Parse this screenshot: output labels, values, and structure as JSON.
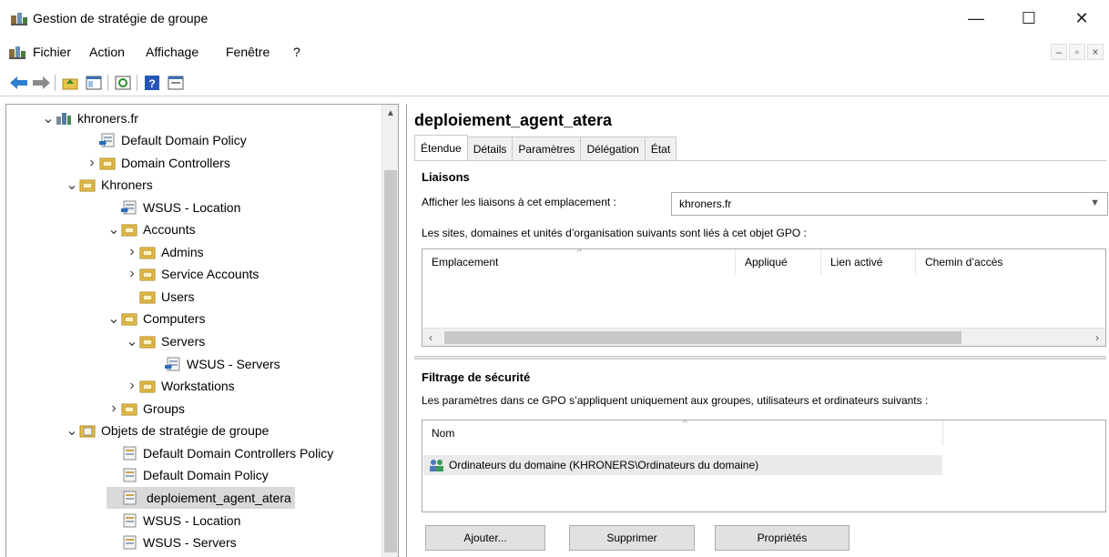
{
  "window": {
    "title": "Gestion de stratégie de groupe",
    "minimize_glyph": "—",
    "maximize_glyph": "☐",
    "close_glyph": "✕"
  },
  "menu": {
    "items": [
      "Fichier",
      "Action",
      "Affichage",
      "Fenêtre",
      "?"
    ],
    "mdi_minimize": "–",
    "mdi_restore": "▫",
    "mdi_close": "×"
  },
  "toolbar": {
    "icons": [
      "back-arrow-icon",
      "forward-arrow-icon",
      "up-folder-icon",
      "show-hide-tree-icon",
      "refresh-icon",
      "help-icon",
      "properties-icon"
    ]
  },
  "tree": {
    "nodes": [
      {
        "label": "khroners.fr",
        "expander": "open",
        "icon": "domain-icon"
      },
      {
        "label": "Default Domain Policy",
        "expander": "none",
        "icon": "gpo-link-icon"
      },
      {
        "label": "Domain Controllers",
        "expander": "closed",
        "icon": "ou-folder-icon"
      },
      {
        "label": "Khroners",
        "expander": "open",
        "icon": "ou-folder-icon"
      },
      {
        "label": "WSUS - Location",
        "expander": "none",
        "icon": "gpo-link-icon"
      },
      {
        "label": "Accounts",
        "expander": "open",
        "icon": "ou-folder-icon"
      },
      {
        "label": "Admins",
        "expander": "closed",
        "icon": "ou-folder-icon"
      },
      {
        "label": "Service Accounts",
        "expander": "closed",
        "icon": "ou-folder-icon"
      },
      {
        "label": "Users",
        "expander": "none",
        "icon": "ou-folder-icon"
      },
      {
        "label": "Computers",
        "expander": "open",
        "icon": "ou-folder-icon"
      },
      {
        "label": "Servers",
        "expander": "open",
        "icon": "ou-folder-icon"
      },
      {
        "label": "WSUS - Servers",
        "expander": "none",
        "icon": "gpo-link-icon"
      },
      {
        "label": "Workstations",
        "expander": "closed",
        "icon": "ou-folder-icon"
      },
      {
        "label": "Groups",
        "expander": "closed",
        "icon": "ou-folder-icon"
      },
      {
        "label": "Objets de stratégie de groupe",
        "expander": "open",
        "icon": "gpo-container-icon"
      },
      {
        "label": "Default Domain Controllers Policy",
        "expander": "none",
        "icon": "gpo-icon"
      },
      {
        "label": "Default Domain Policy",
        "expander": "none",
        "icon": "gpo-icon"
      },
      {
        "label": "deploiement_agent_atera",
        "expander": "none",
        "icon": "gpo-icon",
        "selected": true
      },
      {
        "label": "WSUS - Location",
        "expander": "none",
        "icon": "gpo-icon"
      },
      {
        "label": "WSUS - Servers",
        "expander": "none",
        "icon": "gpo-icon"
      }
    ]
  },
  "details": {
    "gpo_name": "deploiement_agent_atera",
    "tabs": [
      "Étendue",
      "Détails",
      "Paramètres",
      "Délégation",
      "État"
    ],
    "active_tab": "Étendue",
    "links": {
      "title": "Liaisons",
      "show_links_label": "Afficher les liaisons à cet emplacement :",
      "location_value": "khroners.fr",
      "linked_text": "Les sites, domaines et unités d’organisation suivants sont liés à cet objet GPO :",
      "columns": [
        "Emplacement",
        "Appliqué",
        "Lien activé",
        "Chemin d’accès"
      ],
      "rows": []
    },
    "security_filtering": {
      "title": "Filtrage de sécurité",
      "description": "Les paramètres dans ce GPO s’appliquent uniquement aux groupes, utilisateurs et ordinateurs suivants :",
      "columns": [
        "Nom"
      ],
      "rows": [
        "Ordinateurs du domaine (KHRONERS\\Ordinateurs du domaine)"
      ],
      "buttons": {
        "add": "Ajouter...",
        "remove": "Supprimer",
        "properties": "Propriétés"
      }
    }
  }
}
